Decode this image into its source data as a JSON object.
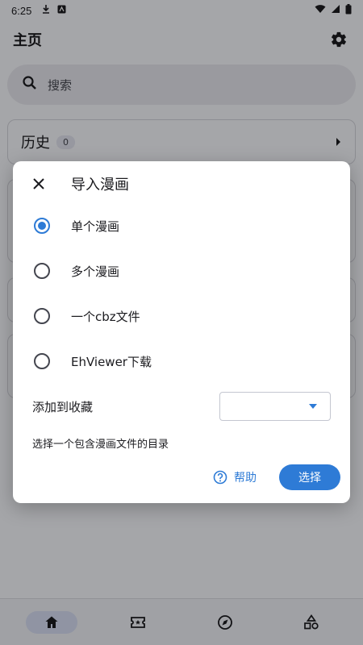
{
  "status_bar": {
    "time": "6:25"
  },
  "app_bar": {
    "title": "主页"
  },
  "search": {
    "placeholder": "搜索"
  },
  "history": {
    "title": "历史",
    "count": "0"
  },
  "dialog": {
    "title": "导入漫画",
    "options": [
      {
        "label": "单个漫画",
        "checked": true
      },
      {
        "label": "多个漫画",
        "checked": false
      },
      {
        "label": "一个cbz文件",
        "checked": false
      },
      {
        "label": "EhViewer下载",
        "checked": false
      }
    ],
    "favorite_label": "添加到收藏",
    "favorite_value": "",
    "hint": "选择一个包含漫画文件的目录",
    "help_label": "帮助",
    "select_label": "选择"
  },
  "colors": {
    "accent": "#2e7bd6",
    "background": "#f4f5f9",
    "scrim": "rgba(0,0,0,0.32)"
  },
  "bottom_nav": [
    {
      "icon": "home-icon",
      "active": true
    },
    {
      "icon": "ticket-icon",
      "active": false
    },
    {
      "icon": "compass-icon",
      "active": false
    },
    {
      "icon": "categories-icon",
      "active": false
    }
  ]
}
